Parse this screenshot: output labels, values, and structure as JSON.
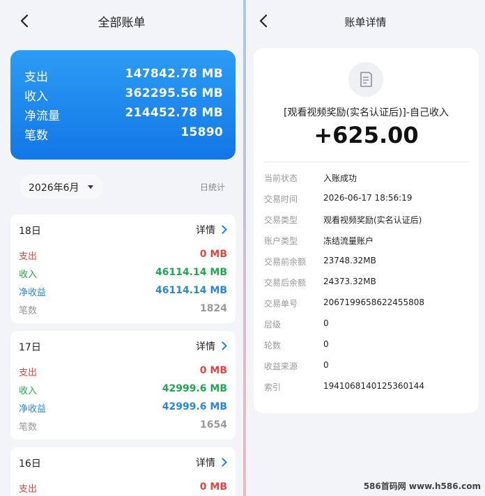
{
  "left": {
    "nav_title": "全部账单",
    "summary": [
      {
        "label": "支出",
        "value": "147842.78 MB"
      },
      {
        "label": "收入",
        "value": "362295.56 MB"
      },
      {
        "label": "净流量",
        "value": "214452.78 MB"
      },
      {
        "label": "笔数",
        "value": "15890"
      }
    ],
    "month_selector": "2026年6月",
    "daily_stats_link": "日统计",
    "days": [
      {
        "title": "18日",
        "detail": "详情",
        "rows": [
          {
            "label": "支出",
            "value": "0 MB"
          },
          {
            "label": "收入",
            "value": "46114.14 MB"
          },
          {
            "label": "净收益",
            "value": "46114.14 MB"
          },
          {
            "label": "笔数",
            "value": "1824"
          }
        ]
      },
      {
        "title": "17日",
        "detail": "详情",
        "rows": [
          {
            "label": "支出",
            "value": "0 MB"
          },
          {
            "label": "收入",
            "value": "42999.6 MB"
          },
          {
            "label": "净收益",
            "value": "42999.6 MB"
          },
          {
            "label": "笔数",
            "value": "1654"
          }
        ]
      },
      {
        "title": "16日",
        "detail": "详情",
        "rows": [
          {
            "label": "支出",
            "value": "0 MB"
          }
        ]
      }
    ]
  },
  "right": {
    "nav_title": "账单详情",
    "description": "[观看视频奖励(实名认证后)]-自己收入",
    "amount": "+625.00",
    "fields": [
      {
        "label": "当前状态",
        "value": "入账成功"
      },
      {
        "label": "交易时间",
        "value": "2026-06-17 18:56:19"
      },
      {
        "label": "交易类型",
        "value": "观看视频奖励(实名认证后)"
      },
      {
        "label": "账户类型",
        "value": "冻结流量账户"
      },
      {
        "label": "交易前余额",
        "value": "23748.32MB"
      },
      {
        "label": "交易后余额",
        "value": "24373.32MB"
      },
      {
        "label": "交易单号",
        "value": "2067199658622455808"
      },
      {
        "label": "层级",
        "value": "0"
      },
      {
        "label": "轮数",
        "value": "0"
      },
      {
        "label": "收益来源",
        "value": "0"
      },
      {
        "label": "索引",
        "value": "1941068140125360144"
      }
    ]
  },
  "watermark": "586首码网 www.h586.com",
  "colors": {
    "accent_blue": "#1a84e8",
    "expense_red": "#e0473e",
    "income_green": "#1fa84f",
    "net_blue": "#2b86d8"
  },
  "icons": {
    "back": "chevron-left-icon",
    "detail": "chevron-right-icon",
    "dropdown": "caret-down-icon",
    "record": "document-icon"
  }
}
